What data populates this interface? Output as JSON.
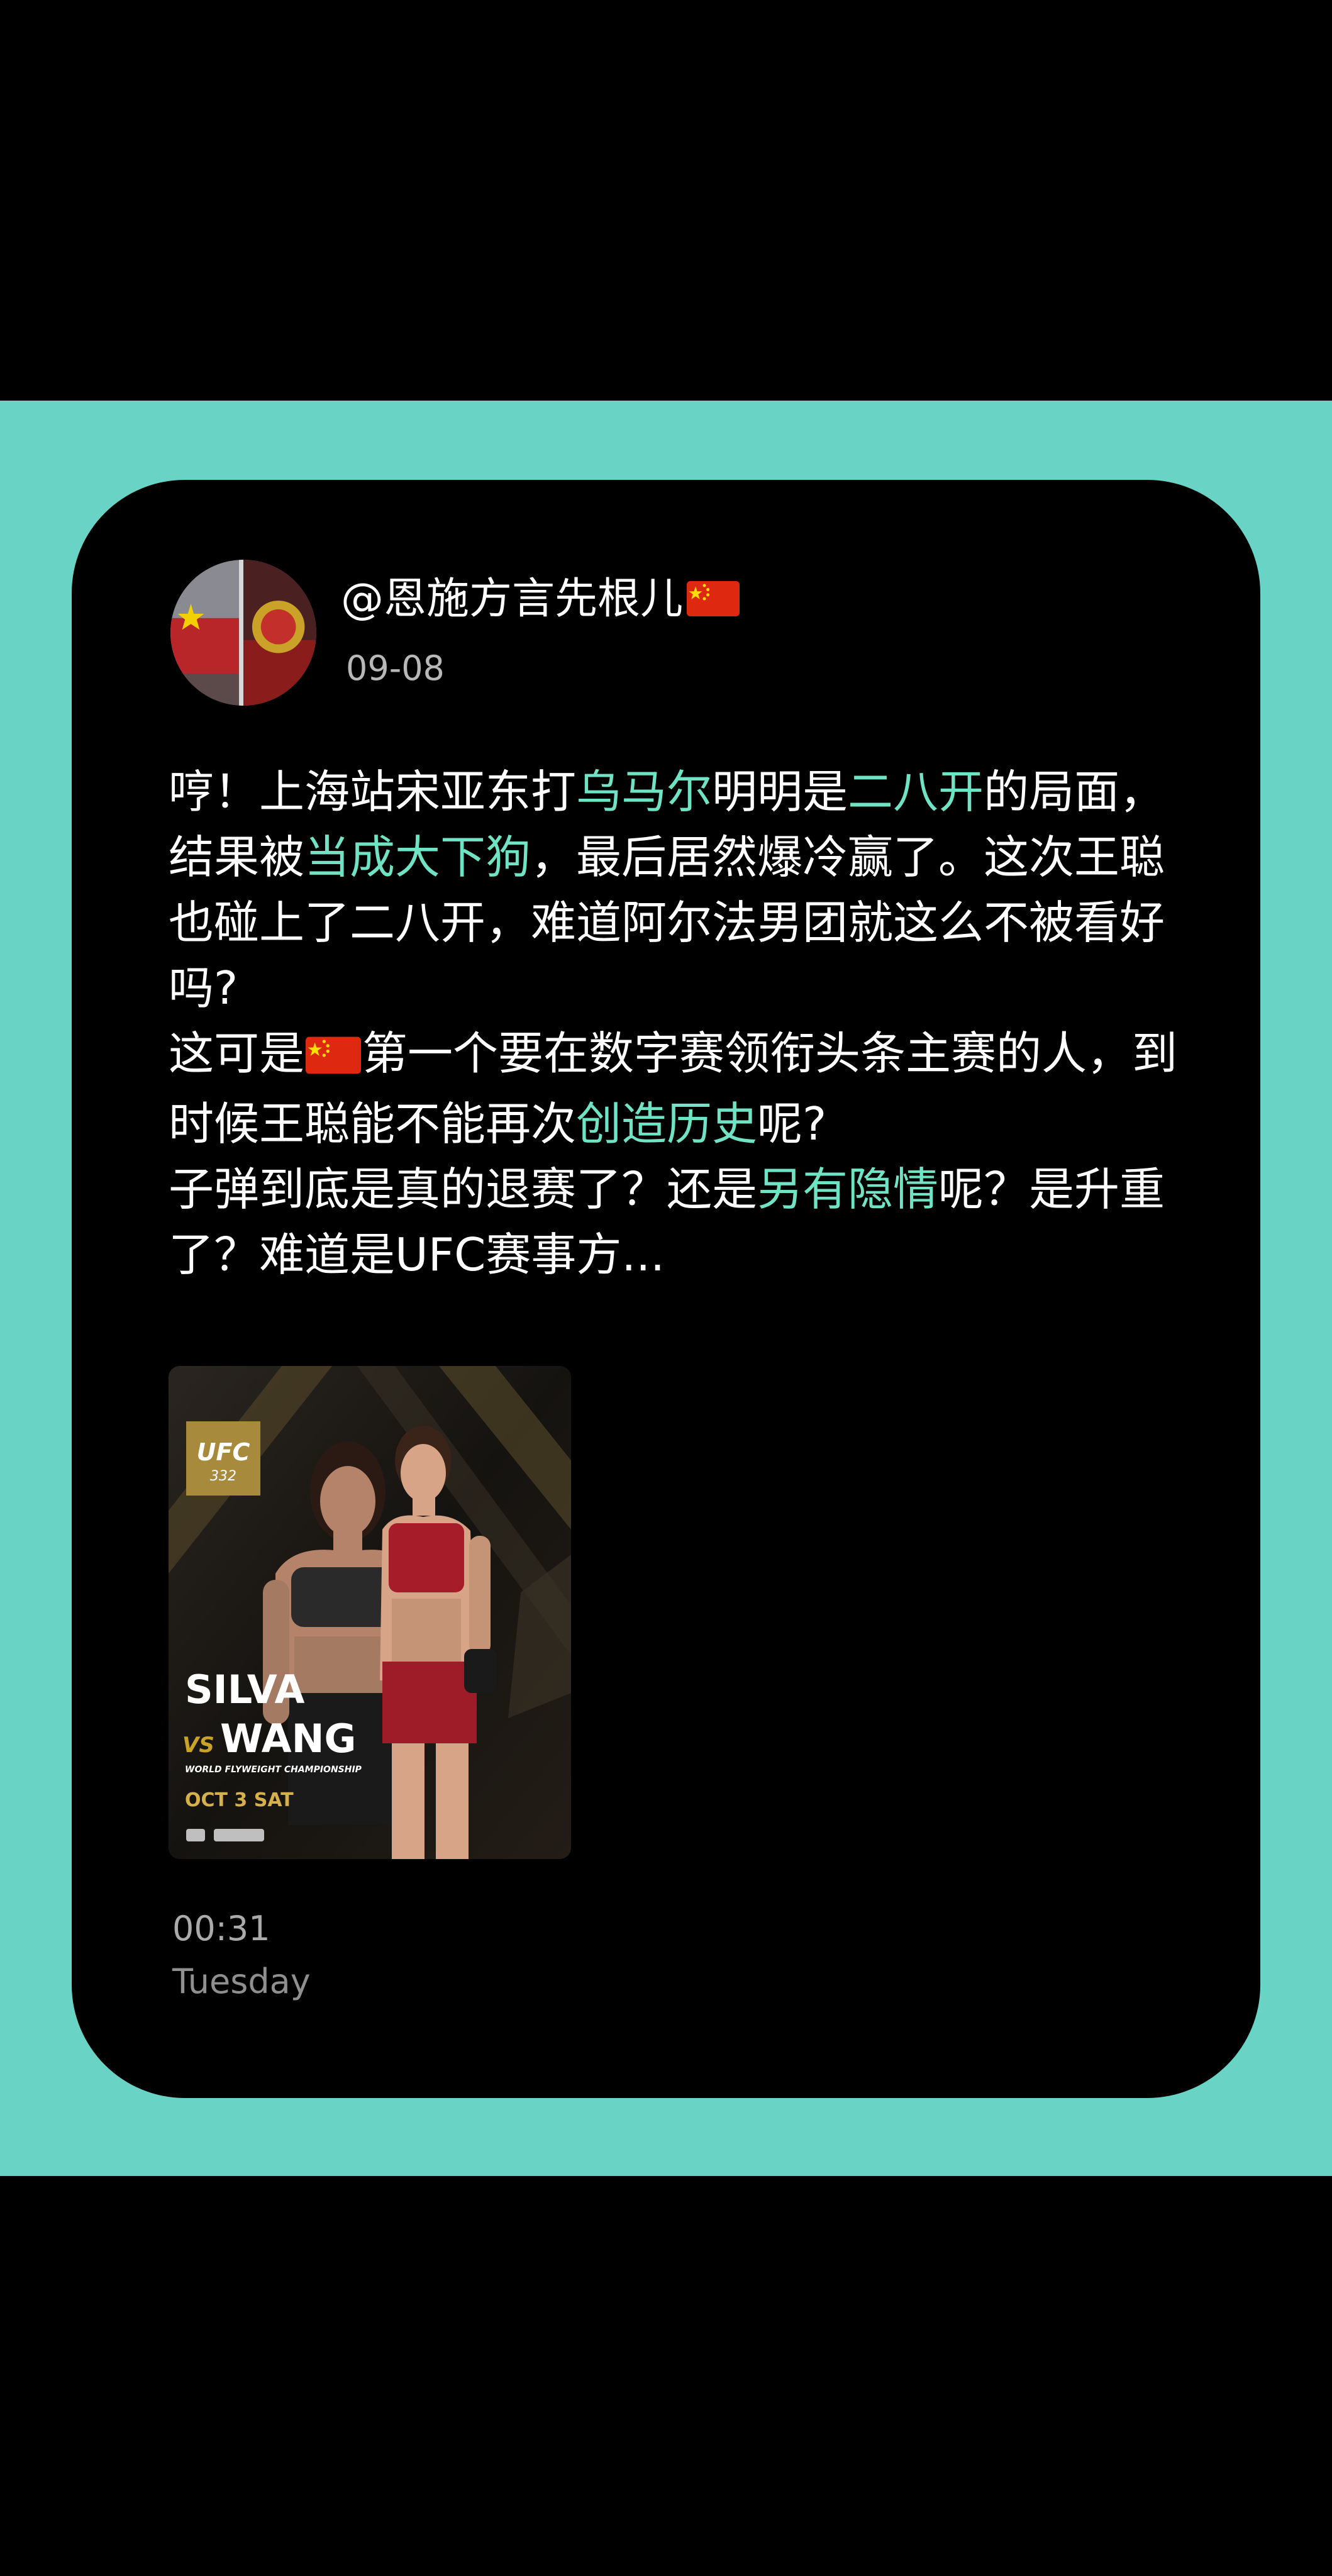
{
  "post": {
    "username": "@恩施方言先根儿",
    "date": "09-08",
    "p1_a": "哼！上海站宋亚东打",
    "p1_hl1": "乌马尔",
    "p1_b": "明明是",
    "p1_hl2": "二八开",
    "p1_c": "的局面，结果被",
    "p1_hl3": "当成大下狗",
    "p1_d": "，最后居然爆冷赢了。这次王聪也碰上了二八开，难道阿尔法男团就这么不被看好吗?",
    "p2_a": "这可是",
    "p2_b": "第一个要在数字赛领衔头条主赛的人，到时候王聪能不能再次",
    "p2_hl": "创造历史",
    "p2_c": "呢?",
    "p3_a": "子弹到底是真的退赛了？还是",
    "p3_hl": "另有隐情",
    "p3_b": "呢？是升重了？难道是UFC赛事方...",
    "time": "00:31",
    "day": "Tuesday"
  },
  "poster": {
    "brand": "UFC",
    "event_number": "332",
    "fighter1": "SILVA",
    "vs": "VS",
    "fighter2": "WANG",
    "subtitle": "WORLD FLYWEIGHT CHAMPIONSHIP",
    "event_date": "OCT 3 SAT"
  },
  "colors": {
    "accent_band": "#69d4c6",
    "highlight": "#6fe3c3",
    "card": "#000000"
  }
}
